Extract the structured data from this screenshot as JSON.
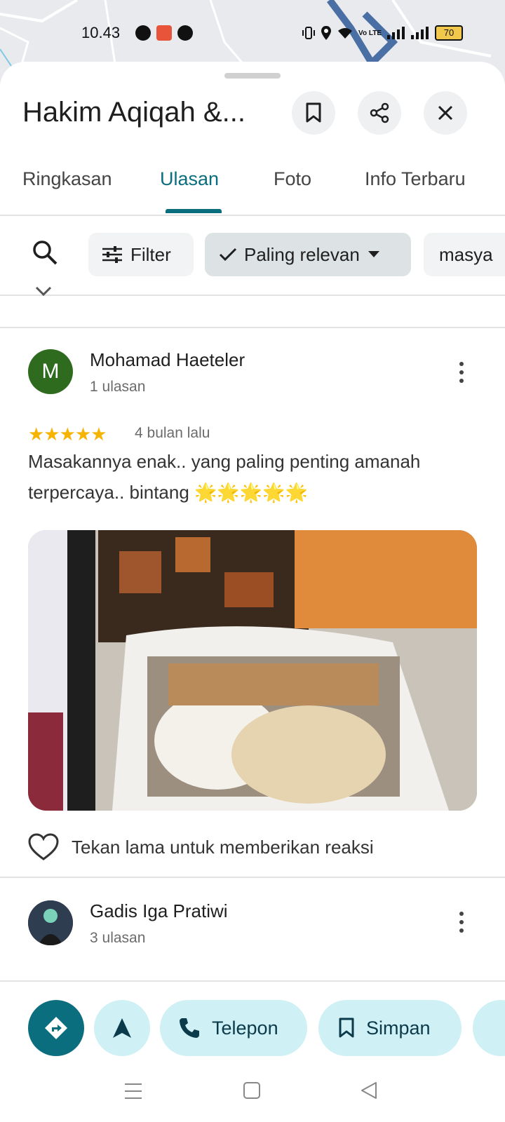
{
  "status_bar": {
    "time": "10.43",
    "network_label": "Vo LTE",
    "battery": "70"
  },
  "place": {
    "title": "Hakim Aqiqah &..."
  },
  "header_actions": {
    "save_icon": "bookmark-icon",
    "share_icon": "share-icon",
    "close_icon": "close-icon"
  },
  "tabs": [
    {
      "label": "Ringkasan",
      "active": false
    },
    {
      "label": "Ulasan",
      "active": true
    },
    {
      "label": "Foto",
      "active": false
    },
    {
      "label": "Info Terbaru",
      "active": false
    }
  ],
  "filters": {
    "search_icon": "search-icon",
    "filter_label": "Filter",
    "sort_label": "Paling relevan",
    "topic_label": "masya"
  },
  "reviews": [
    {
      "avatar_letter": "M",
      "avatar_color": "#2e6b1f",
      "name": "Mohamad Haeteler",
      "count": "1 ulasan",
      "rating": 5,
      "stars": "★★★★★",
      "when": "4 bulan lalu",
      "text": "Masakannya enak.. yang paling penting amanah terpercaya.. bintang 🌟🌟🌟🌟🌟",
      "reaction_hint": "Tekan lama untuk memberikan reaksi"
    },
    {
      "name": "Gadis Iga Pratiwi",
      "count": "3 ulasan"
    }
  ],
  "bottom_actions": {
    "directions_icon": "directions-icon",
    "start_icon": "navigation-icon",
    "call_label": "Telepon",
    "save_label": "Simpan"
  },
  "colors": {
    "accent": "#0b6e7f",
    "chip_bg": "#cff0f5",
    "star": "#f6b400"
  }
}
